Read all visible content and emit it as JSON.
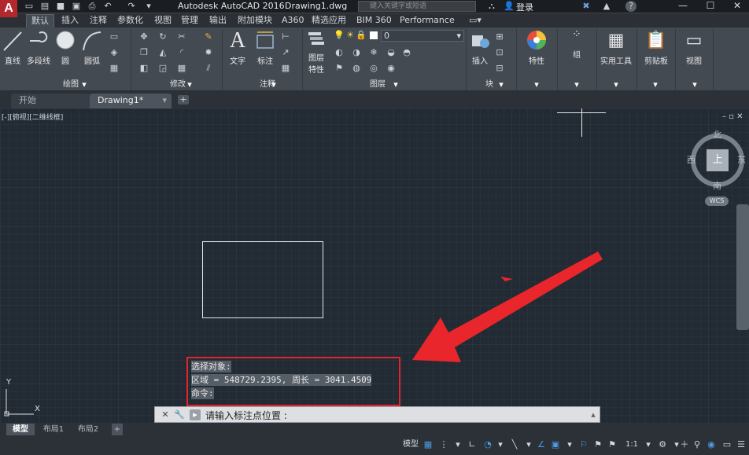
{
  "title_bar": {
    "logo": "A",
    "app_title": "Autodesk AutoCAD 2016",
    "document": "Drawing1.dwg",
    "search_placeholder": "键入关键字或短语",
    "login": "登录"
  },
  "ribbon_tabs": [
    "默认",
    "插入",
    "注释",
    "参数化",
    "视图",
    "管理",
    "输出",
    "附加模块",
    "A360",
    "精选应用",
    "BIM 360",
    "Performance"
  ],
  "draw_panel": {
    "title": "绘图",
    "tools": [
      "直线",
      "多段线",
      "圆",
      "圆弧"
    ]
  },
  "modify_panel": {
    "title": "修改"
  },
  "annotation_panel": {
    "title": "注释",
    "tools": [
      "文字",
      "标注"
    ]
  },
  "layer_panel": {
    "title": "图层",
    "properties_label": "图层",
    "properties_label2": "特性",
    "current_layer": "0"
  },
  "block_panel": {
    "title": "块",
    "insert_label": "插入"
  },
  "properties_panel": {
    "label": "特性"
  },
  "group_panel": {
    "label": "组"
  },
  "utilities_panel": {
    "label": "实用工具"
  },
  "clipboard_panel": {
    "label": "剪贴板"
  },
  "view_panel": {
    "label": "视图"
  },
  "file_tabs": [
    {
      "label": "开始"
    },
    {
      "label": "Drawing1*"
    }
  ],
  "viewport_label": "[-][俯视][二维线框]",
  "viewcube": {
    "top": "上",
    "north": "北",
    "south": "南",
    "east": "东",
    "west": "西",
    "wcs": "WCS"
  },
  "ucs": {
    "x": "X",
    "y": "Y"
  },
  "command_history": [
    "选择对象:",
    "区域 = 548729.2395, 周长 = 3041.4509",
    "命令:"
  ],
  "command_line": {
    "prompt": "请输入标注点位置 :"
  },
  "layout_tabs": [
    "模型",
    "布局1",
    "布局2"
  ],
  "status_bar": {
    "model_label": "模型",
    "scale": "1:1"
  },
  "colors": {
    "highlight_box": "#e0262c",
    "arrow": "#e8262b",
    "canvas": "#222a33"
  }
}
